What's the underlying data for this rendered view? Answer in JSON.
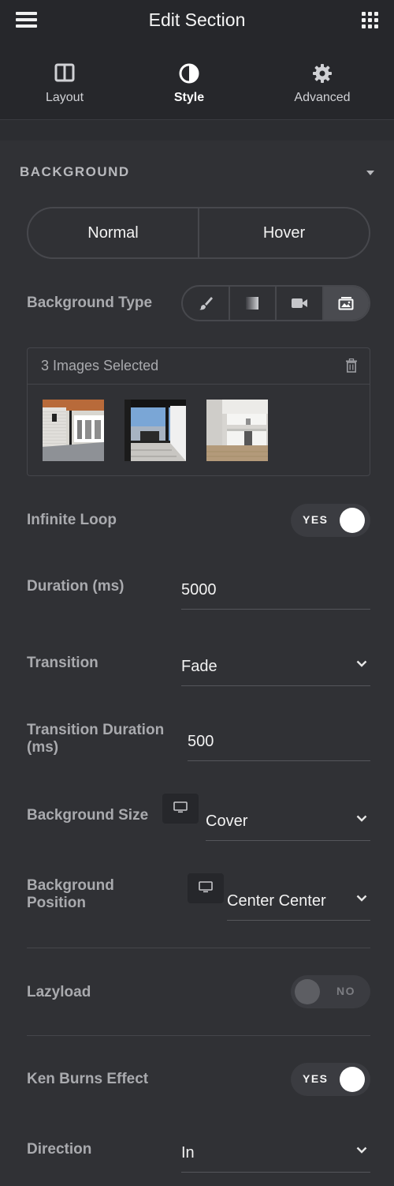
{
  "header": {
    "title": "Edit Section"
  },
  "tabs": [
    {
      "label": "Layout",
      "icon": "columns-icon"
    },
    {
      "label": "Style",
      "icon": "contrast-icon",
      "active": true
    },
    {
      "label": "Advanced",
      "icon": "gear-icon"
    }
  ],
  "section": {
    "title": "BACKGROUND"
  },
  "state_toggle": {
    "normal": "Normal",
    "hover": "Hover",
    "selected": "Normal"
  },
  "background_type": {
    "label": "Background Type",
    "options": [
      "brush-icon",
      "gradient-icon",
      "video-icon",
      "slideshow-icon"
    ],
    "selected": "slideshow-icon"
  },
  "gallery": {
    "count_label": "3 Images Selected",
    "images": [
      "porch-photo",
      "patio-photo",
      "kitchen-photo"
    ]
  },
  "infinite_loop": {
    "label": "Infinite Loop",
    "value": "YES"
  },
  "duration": {
    "label": "Duration (ms)",
    "value": "5000"
  },
  "transition": {
    "label": "Transition",
    "value": "Fade"
  },
  "transition_duration": {
    "label": "Transition Duration (ms)",
    "value": "500"
  },
  "background_size": {
    "label": "Background Size",
    "value": "Cover"
  },
  "background_position": {
    "label": "Background Position",
    "value": "Center Center"
  },
  "lazyload": {
    "label": "Lazyload",
    "value": "NO"
  },
  "ken_burns": {
    "label": "Ken Burns Effect",
    "value": "YES"
  },
  "direction": {
    "label": "Direction",
    "value": "In"
  },
  "colors": {
    "panel_bg": "#303135",
    "header_bg": "#26272b",
    "text": "#f2f2f2",
    "label": "#a9aaae"
  }
}
